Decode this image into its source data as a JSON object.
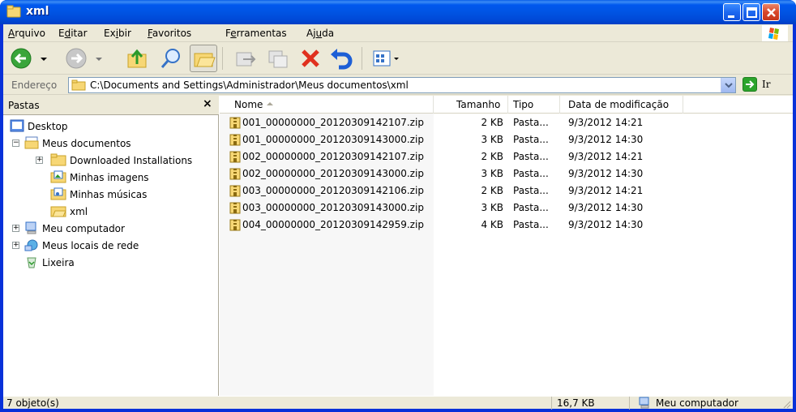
{
  "window": {
    "title": "xml",
    "accent": "#0054e3"
  },
  "menu": {
    "items": [
      {
        "pre": "",
        "u": "A",
        "post": "rquivo"
      },
      {
        "pre": "E",
        "u": "d",
        "post": "itar"
      },
      {
        "pre": "Ex",
        "u": "i",
        "post": "bir"
      },
      {
        "pre": "",
        "u": "F",
        "post": "avoritos"
      },
      {
        "pre": "F",
        "u": "e",
        "post": "rramentas"
      },
      {
        "pre": "Aj",
        "u": "u",
        "post": "da"
      }
    ]
  },
  "toolbar": {
    "buttons": [
      "back-icon",
      "forward-icon",
      "up-folder-icon",
      "search-icon",
      "folders-icon",
      "move-to-icon",
      "copy-to-icon",
      "delete-icon",
      "undo-icon",
      "views-icon"
    ]
  },
  "address": {
    "label": "Endereço",
    "path": "C:\\Documents and Settings\\Administrador\\Meus documentos\\xml",
    "go_label": "Ir"
  },
  "folders_pane": {
    "title": "Pastas",
    "close": "×",
    "tree": {
      "desktop": "Desktop",
      "my_documents": "Meus documentos",
      "downloaded": "Downloaded Installations",
      "my_pictures": "Minhas imagens",
      "my_music": "Minhas músicas",
      "xml": "xml",
      "my_computer": "Meu computador",
      "network": "Meus locais de rede",
      "recycle": "Lixeira"
    }
  },
  "file_list": {
    "columns": {
      "name": "Nome",
      "size": "Tamanho",
      "type": "Tipo",
      "modified": "Data de modificação"
    },
    "files": [
      {
        "name": "001_00000000_20120309142107.zip",
        "size": "2 KB",
        "type": "Pasta...",
        "modified": "9/3/2012 14:21"
      },
      {
        "name": "001_00000000_20120309143000.zip",
        "size": "3 KB",
        "type": "Pasta...",
        "modified": "9/3/2012 14:30"
      },
      {
        "name": "002_00000000_20120309142107.zip",
        "size": "2 KB",
        "type": "Pasta...",
        "modified": "9/3/2012 14:21"
      },
      {
        "name": "002_00000000_20120309143000.zip",
        "size": "3 KB",
        "type": "Pasta...",
        "modified": "9/3/2012 14:30"
      },
      {
        "name": "003_00000000_20120309142106.zip",
        "size": "2 KB",
        "type": "Pasta...",
        "modified": "9/3/2012 14:21"
      },
      {
        "name": "003_00000000_20120309143000.zip",
        "size": "3 KB",
        "type": "Pasta...",
        "modified": "9/3/2012 14:30"
      },
      {
        "name": "004_00000000_20120309142959.zip",
        "size": "4 KB",
        "type": "Pasta...",
        "modified": "9/3/2012 14:30"
      }
    ]
  },
  "status": {
    "objects": "7 objeto(s)",
    "size": "16,7 KB",
    "location": "Meu computador"
  }
}
